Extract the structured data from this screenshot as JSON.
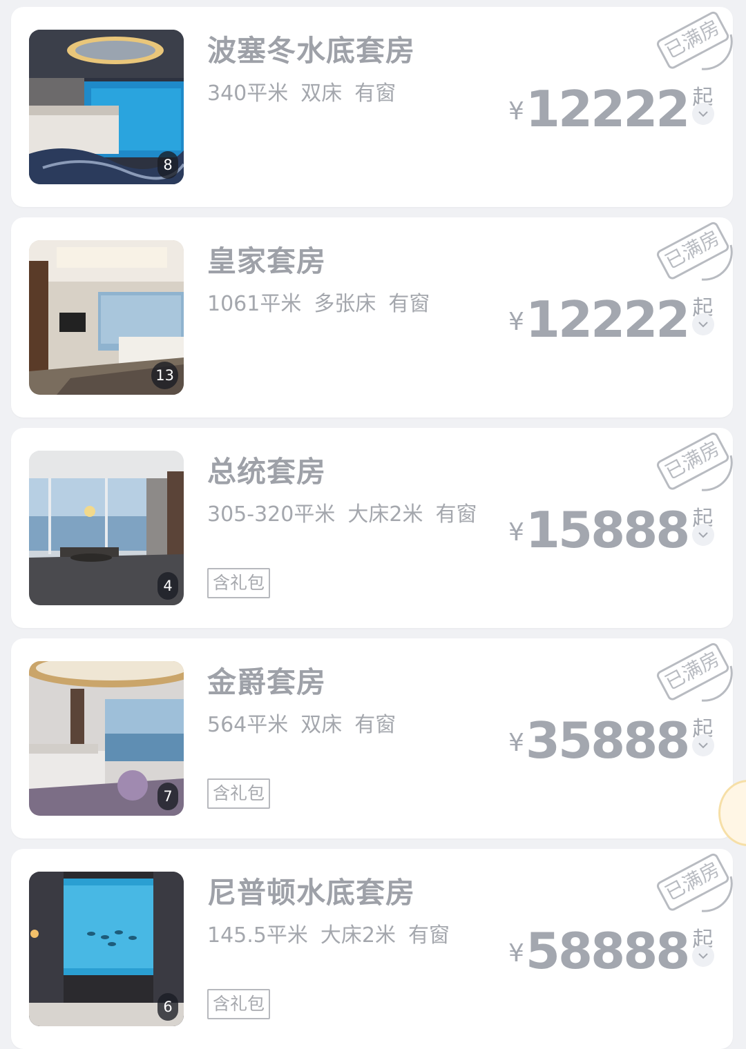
{
  "rooms": [
    {
      "name": "波塞冬水底套房",
      "specs": [
        "340平米",
        "双床",
        "有窗"
      ],
      "photo_count": "8",
      "currency": "¥",
      "price": "12222",
      "price_suffix": "起",
      "status_stamp": "已满房",
      "tag": null,
      "photo_icon": "underwater-suite-photo"
    },
    {
      "name": "皇家套房",
      "specs": [
        "1061平米",
        "多张床",
        "有窗"
      ],
      "photo_count": "13",
      "currency": "¥",
      "price": "12222",
      "price_suffix": "起",
      "status_stamp": "已满房",
      "tag": null,
      "photo_icon": "royal-suite-photo"
    },
    {
      "name": "总统套房",
      "specs": [
        "305-320平米",
        "大床2米",
        "有窗"
      ],
      "photo_count": "4",
      "currency": "¥",
      "price": "15888",
      "price_suffix": "起",
      "status_stamp": "已满房",
      "tag": "含礼包",
      "photo_icon": "presidential-suite-photo"
    },
    {
      "name": "金爵套房",
      "specs": [
        "564平米",
        "双床",
        "有窗"
      ],
      "photo_count": "7",
      "currency": "¥",
      "price": "35888",
      "price_suffix": "起",
      "status_stamp": "已满房",
      "tag": "含礼包",
      "photo_icon": "grand-suite-photo"
    },
    {
      "name": "尼普顿水底套房",
      "specs": [
        "145.5平米",
        "大床2米",
        "有窗"
      ],
      "photo_count": "6",
      "currency": "¥",
      "price": "58888",
      "price_suffix": "起",
      "status_stamp": "已满房",
      "tag": "含礼包",
      "photo_icon": "neptune-underwater-suite-photo"
    }
  ],
  "colors": {
    "background": "#f0f1f4",
    "card": "#ffffff",
    "muted_text": "#a3a7af",
    "stamp": "#b8bbc1"
  }
}
